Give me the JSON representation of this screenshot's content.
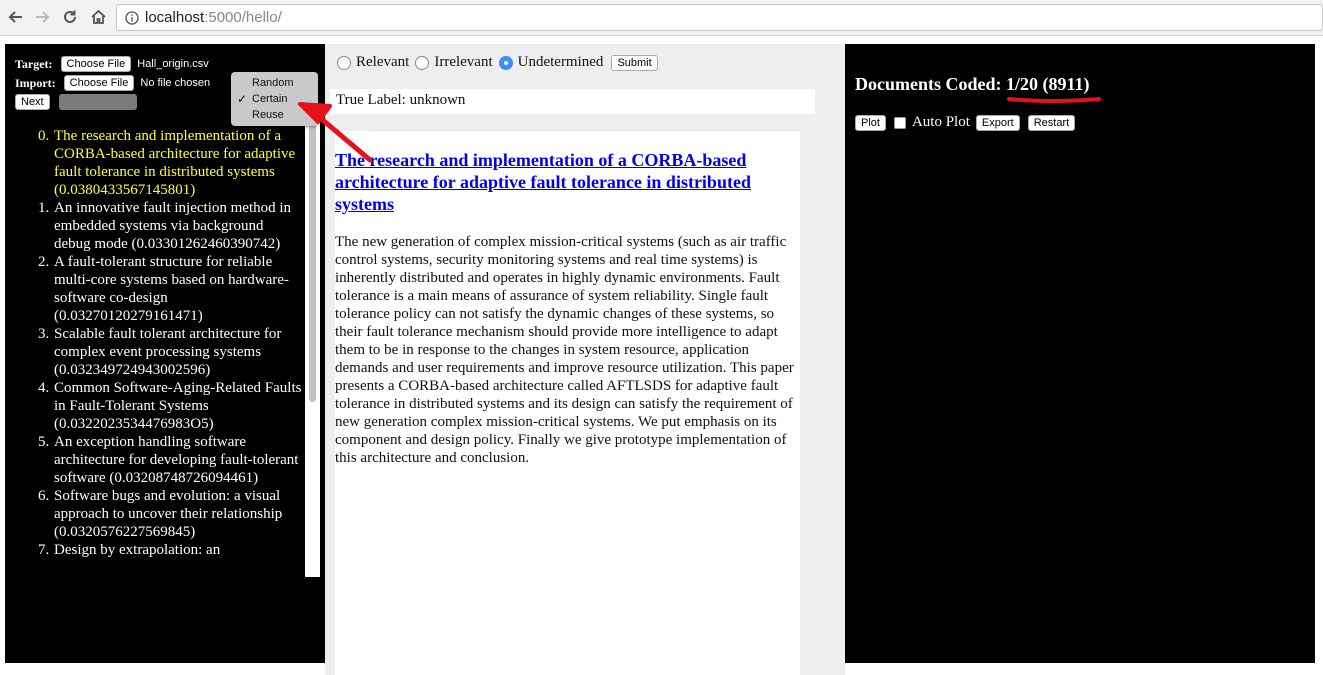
{
  "browser": {
    "url_host": "localhost",
    "url_path": ":5000/hello/",
    "back_icon": "back-arrow-icon",
    "forward_icon": "forward-arrow-icon",
    "reload_icon": "reload-icon",
    "home_icon": "home-icon",
    "info_icon": "info-icon"
  },
  "left": {
    "target_label": "Target:",
    "choose_file_label": "Choose File",
    "target_file": "Hall_origin.csv",
    "import_label": "Import:",
    "import_file": "No file chosen",
    "next_label": "Next",
    "dropdown": {
      "options": [
        "Random",
        "Certain",
        "Reuse"
      ],
      "selected": "Certain",
      "check_mark": "✓"
    },
    "items": [
      {
        "num": "0.",
        "text": "The research and implementation of a CORBA-based architecture for adaptive fault tolerance in distributed systems (0.0380433567145801)"
      },
      {
        "num": "1.",
        "text": "An innovative fault injection method in embedded systems via background debug mode (0.03301262460390742)"
      },
      {
        "num": "2.",
        "text": "A fault-tolerant structure for reliable multi-core systems based on hardware-software co-design (0.03270120279161471)"
      },
      {
        "num": "3.",
        "text": "Scalable fault tolerant architecture for complex event processing systems (0.032349724943002596)"
      },
      {
        "num": "4.",
        "text": "Common Software-Aging-Related Faults in Fault-Tolerant Systems (0.0322023534476983O5)"
      },
      {
        "num": "5.",
        "text": "An exception handling software architecture for developing fault-tolerant software (0.03208748726094461)"
      },
      {
        "num": "6.",
        "text": "Software bugs and evolution: a visual approach to uncover their relationship (0.0320576227569845)"
      },
      {
        "num": "7.",
        "text": "Design by extrapolation: an"
      }
    ]
  },
  "middle": {
    "radios": [
      {
        "label": "Relevant",
        "checked": false
      },
      {
        "label": "Irrelevant",
        "checked": false
      },
      {
        "label": "Undetermined",
        "checked": true
      }
    ],
    "submit_label": "Submit",
    "true_label": "True Label: unknown",
    "doc_title": "The research and implementation of a CORBA-based architecture for adaptive fault tolerance in distributed systems",
    "doc_abstract": "The new generation of complex mission-critical systems (such as air traffic control systems, security monitoring systems and real time systems) is inherently distributed and operates in highly dynamic environments. Fault tolerance is a main means of assurance of system reliability. Single fault tolerance policy can not satisfy the dynamic changes of these systems, so their fault tolerance mechanism should provide more intelligence to adapt them to be in response to the changes in system resource, application demands and user requirements and improve resource utilization. This paper presents a CORBA-based architecture called AFTLSDS for adaptive fault tolerance in distributed systems and its design can satisfy the requirement of new generation complex mission-critical systems. We put emphasis on its component and design policy. Finally we give prototype implementation of this architecture and conclusion."
  },
  "right": {
    "coded_label": "Documents Coded:",
    "coded_value": "1/20 (8911)",
    "plot_label": "Plot",
    "autoplot_label": "Auto Plot",
    "export_label": "Export",
    "restart_label": "Restart"
  },
  "colors": {
    "annotation_red": "#e3121b",
    "selected_item": "#ffff2e",
    "link_blue": "#0000ee"
  }
}
